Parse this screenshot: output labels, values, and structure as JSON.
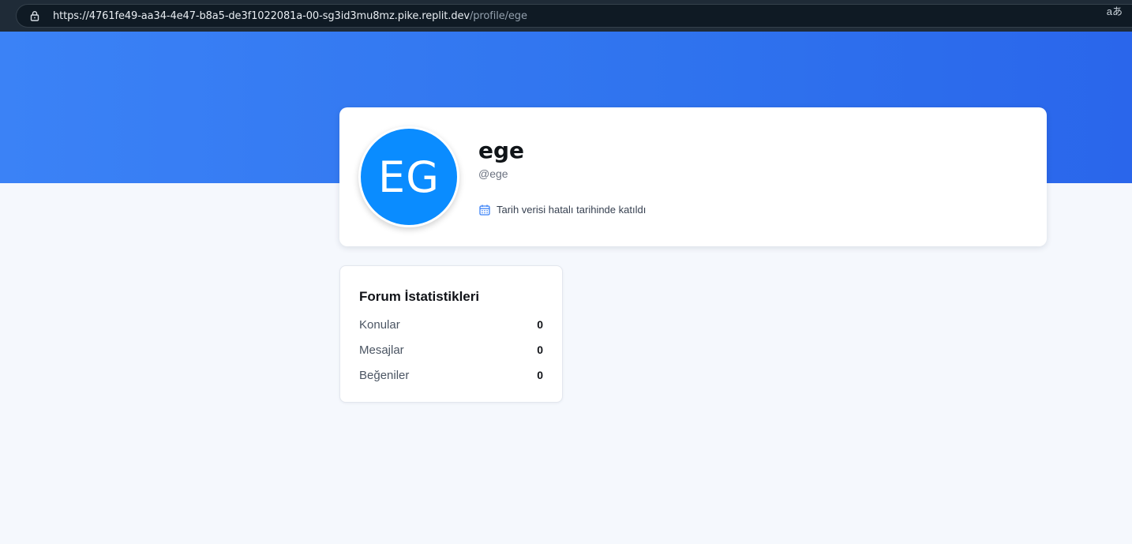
{
  "browser": {
    "url_origin": "https://4761fe49-aa34-4e47-b8a5-de3f1022081a-00-sg3id3mu8mz.pike.replit.dev",
    "url_path": "/profile/ege",
    "translate_glyph": "aあ"
  },
  "profile": {
    "avatar_initials": "EG",
    "display_name": "ege",
    "username": "@ege",
    "joined_text": "Tarih verisi hatalı tarihinde katıldı",
    "avatar_color": "#0a8cff",
    "banner_color": "#3b82f6"
  },
  "stats": {
    "title": "Forum İstatistikleri",
    "items": [
      {
        "label": "Konular",
        "value": "0"
      },
      {
        "label": "Mesajlar",
        "value": "0"
      },
      {
        "label": "Beğeniler",
        "value": "0"
      }
    ]
  }
}
